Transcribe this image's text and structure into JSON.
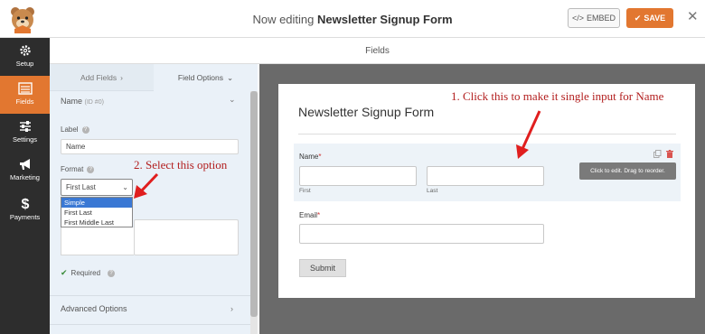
{
  "header": {
    "title_prefix": "Now editing",
    "title_name": "Newsletter Signup Form",
    "embed_label": "EMBED",
    "save_label": "SAVE"
  },
  "nav": {
    "items": [
      {
        "label": "Setup",
        "icon": "gear-icon"
      },
      {
        "label": "Fields",
        "icon": "list-icon",
        "active": true
      },
      {
        "label": "Settings",
        "icon": "sliders-icon"
      },
      {
        "label": "Marketing",
        "icon": "megaphone-icon"
      },
      {
        "label": "Payments",
        "icon": "dollar-icon"
      }
    ]
  },
  "fields_header": "Fields",
  "panel": {
    "tab_add": "Add Fields",
    "tab_options": "Field Options",
    "field_name": "Name",
    "field_id": "(ID #0)",
    "label_caption": "Label",
    "label_value": "Name",
    "format_caption": "Format",
    "format_value": "First Last",
    "format_options": [
      "Simple",
      "First Last",
      "First Middle Last"
    ],
    "required_label": "Required",
    "advanced_label": "Advanced Options"
  },
  "preview": {
    "form_title": "Newsletter Signup Form",
    "name_label": "Name",
    "first_sublabel": "First",
    "last_sublabel": "Last",
    "email_label": "Email",
    "required_mark": "*",
    "tooltip": "Click to edit. Drag to reorder.",
    "submit_label": "Submit"
  },
  "annotations": {
    "one": "1. Click this to make it single input for Name",
    "two": "2. Select this option"
  },
  "colors": {
    "accent": "#e27730",
    "nav_bg": "#2d2d2d",
    "annotation": "#b32020",
    "selected_option": "#3a78d4"
  }
}
